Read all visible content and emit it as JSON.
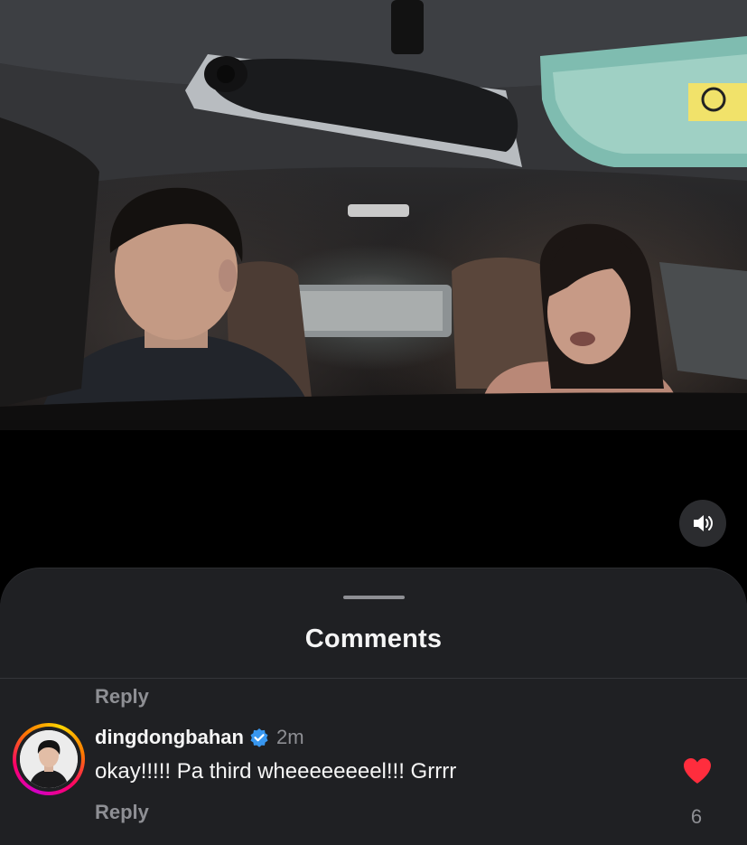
{
  "video": {
    "sound_icon": "speaker-volume-icon"
  },
  "comments_sheet": {
    "title": "Comments",
    "previous_reply_label": "Reply",
    "comment": {
      "username": "dingdongbahan",
      "verified_icon": "verified-badge-icon",
      "time": "2m",
      "text": "okay!!!!! Pa third wheeeeeeeel!!! Grrrr",
      "reply_label": "Reply",
      "like_icon": "heart-filled-icon",
      "like_count": "6"
    }
  },
  "colors": {
    "like": "#ff2d3d",
    "verified": "#3897f0",
    "sheet_background": "#1f2023"
  }
}
